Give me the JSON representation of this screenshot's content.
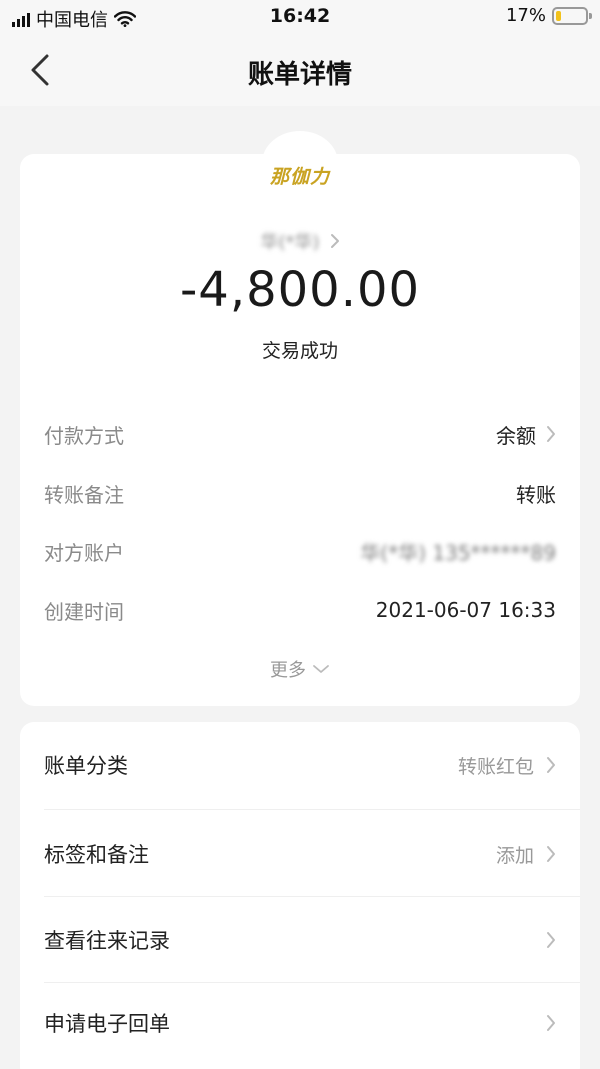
{
  "status_bar": {
    "carrier": "中国电信",
    "time": "16:42",
    "battery": "17%",
    "battery_level": 0.17,
    "battery_color": "#f2c21b"
  },
  "nav": {
    "back_icon": "chevron-left-icon",
    "title": "账单详情"
  },
  "summary": {
    "merchant_logo_text": "那伽力",
    "payee_name_blurred": "华(*华)",
    "amount": "-4,800.00",
    "status": "交易成功"
  },
  "details": [
    {
      "label": "付款方式",
      "value": "余额",
      "has_chevron": true
    },
    {
      "label": "转账备注",
      "value": "转账",
      "has_chevron": false
    },
    {
      "label": "对方账户",
      "value": "华(*华) 135******89",
      "blurred": true,
      "has_chevron": false
    },
    {
      "label": "创建时间",
      "value": "2021-06-07 16:33",
      "has_chevron": false
    }
  ],
  "more": {
    "label": "更多",
    "icon": "chevron-down-icon"
  },
  "menu": [
    {
      "label": "账单分类",
      "value": "转账红包"
    },
    {
      "label": "标签和备注",
      "value": "添加"
    },
    {
      "label": "查看往来记录",
      "value": ""
    },
    {
      "label": "申请电子回单",
      "value": ""
    }
  ],
  "colors": {
    "background": "#f3f3f3",
    "card": "#ffffff",
    "logo_gold": "#c9a322",
    "muted_text": "#8a8a8a"
  }
}
